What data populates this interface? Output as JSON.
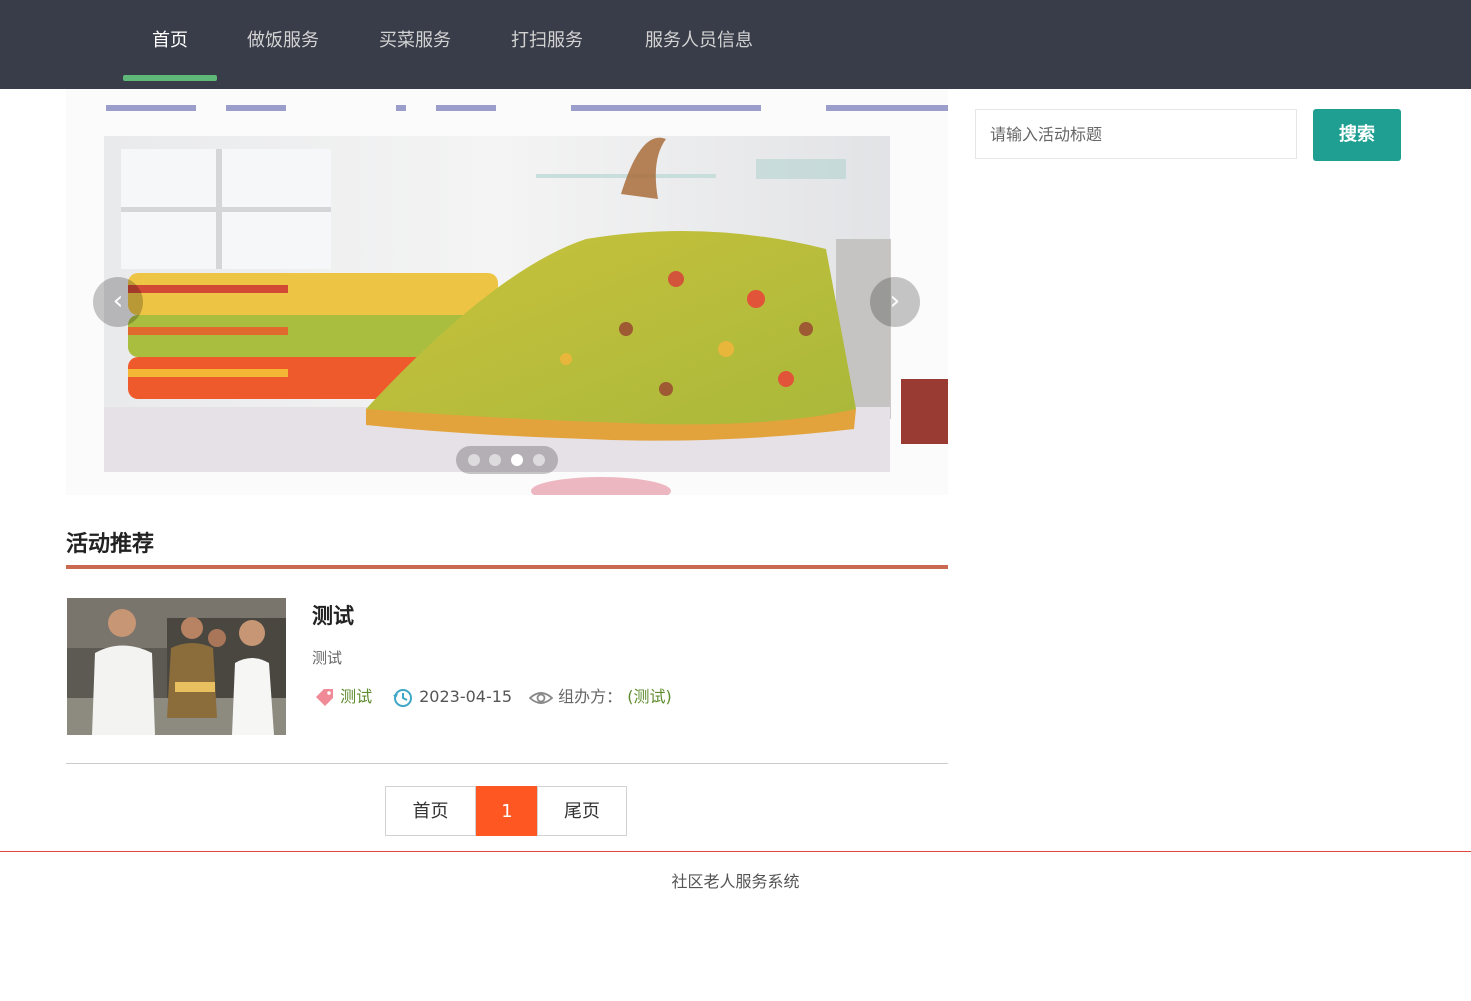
{
  "nav": {
    "items": [
      {
        "label": "首页",
        "active": true
      },
      {
        "label": "做饭服务",
        "active": false
      },
      {
        "label": "买菜服务",
        "active": false
      },
      {
        "label": "打扫服务",
        "active": false
      },
      {
        "label": "服务人员信息",
        "active": false
      }
    ],
    "active_color": "#5fb878",
    "bg_color": "#393d49"
  },
  "carousel": {
    "slide_count": 4,
    "active_index": 2,
    "prev_icon": "chevron-left-icon",
    "next_icon": "chevron-right-icon"
  },
  "search": {
    "placeholder": "请输入活动标题",
    "value": "",
    "button_label": "搜索",
    "button_color": "#1e9f91"
  },
  "section": {
    "title": "活动推荐",
    "accent_color": "#c9694f"
  },
  "activities": [
    {
      "title": "测试",
      "description": "测试",
      "tag": "测试",
      "date": "2023-04-15",
      "organizer_label": "组办方：",
      "organizer": "(测试)",
      "tag_icon": "tag-icon",
      "date_icon": "history-icon",
      "organizer_icon": "eye-icon"
    }
  ],
  "pagination": {
    "first_label": "首页",
    "current_page": "1",
    "last_label": "尾页",
    "current_color": "#ff5722"
  },
  "footer": {
    "text": "社区老人服务系统"
  }
}
